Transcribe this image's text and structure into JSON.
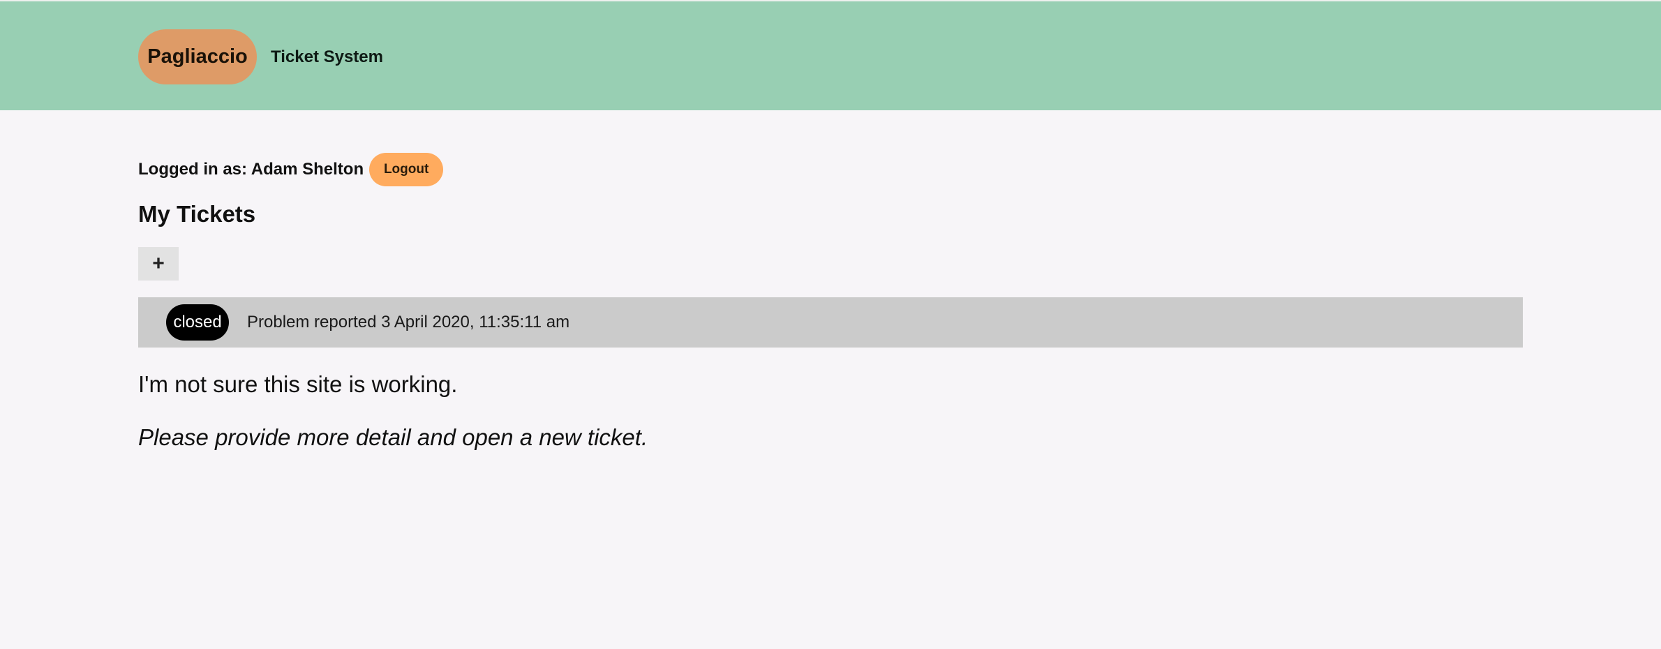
{
  "header": {
    "brand": "Pagliaccio",
    "subtitle": "Ticket System",
    "background_color": "#98cfb3",
    "brand_color": "#de9b67"
  },
  "session": {
    "logged_in_text": "Logged in as: Adam Shelton",
    "logout_label": "Logout",
    "logout_color": "#ffab5e"
  },
  "main": {
    "title": "My Tickets",
    "add_label": "+"
  },
  "tickets": [
    {
      "status": "closed",
      "summary": "Problem reported 3 April 2020, 11:35:11 am",
      "description": "I'm not sure this site is working.",
      "response": "Please provide more detail and open a new ticket."
    }
  ]
}
